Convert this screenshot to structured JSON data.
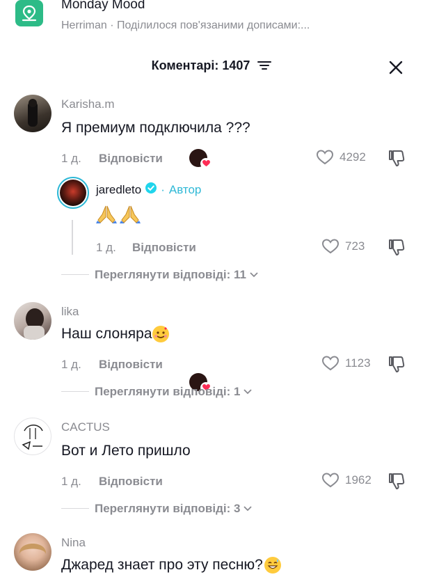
{
  "header": {
    "sound_title": "Monday Mood",
    "sound_subtitle": "Herriman · Поділилося пов'язаними дописами:..."
  },
  "comments_panel": {
    "title": "Коментарі: 1407"
  },
  "comments": [
    {
      "username": "Karisha.m",
      "text": "Я премиум подключила ???",
      "age": "1 д.",
      "reply_label": "Відповісти",
      "likes": "4292",
      "creator_liked": true,
      "reply": {
        "username": "jaredleto",
        "verified": true,
        "author_label": "Автор",
        "age": "1 д.",
        "reply_label": "Відповісти",
        "likes": "723"
      },
      "view_replies": "Переглянути відповіді: 11"
    },
    {
      "username": "lika",
      "text": "Наш слоняра",
      "age": "1 д.",
      "reply_label": "Відповісти",
      "likes": "1123",
      "creator_liked": true,
      "view_replies": "Переглянути відповіді: 1"
    },
    {
      "username": "CACTUS",
      "text": "Вот и Лето пришло",
      "age": "1 д.",
      "reply_label": "Відповісти",
      "likes": "1962",
      "creator_liked": false,
      "view_replies": "Переглянути відповіді: 3"
    },
    {
      "username": "Nina",
      "text": "Джаред знает про эту песню?"
    }
  ],
  "colors": {
    "accent_author": "#2eb8d6",
    "mood_icon_bg": "#2dbb87",
    "muted_text": "#8a8b91"
  }
}
